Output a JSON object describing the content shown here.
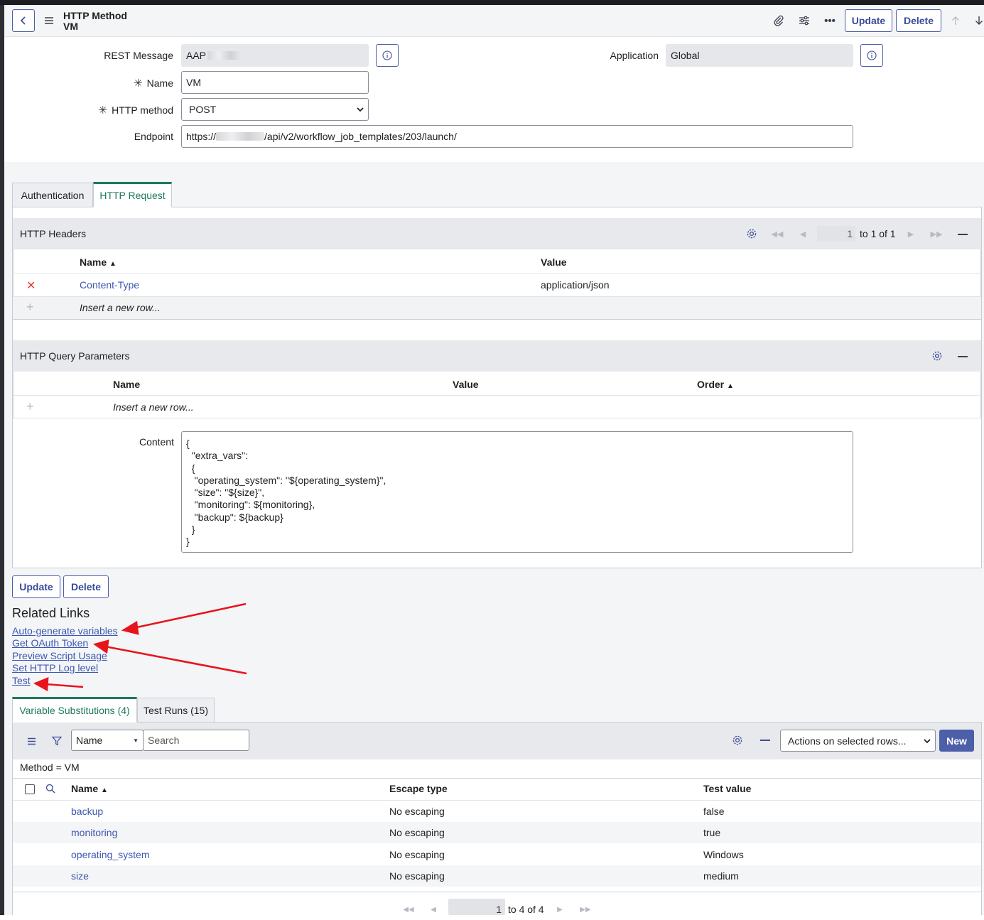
{
  "header": {
    "title_line1": "HTTP Method",
    "title_line2": "VM",
    "update_label": "Update",
    "delete_label": "Delete",
    "icons": [
      "back-icon",
      "menu-icon",
      "attachment-icon",
      "settings-sliders-icon",
      "more-icon",
      "arrow-up-icon",
      "arrow-down-icon"
    ]
  },
  "form": {
    "rest_message_label": "REST Message",
    "rest_message_value": "AAP",
    "application_label": "Application",
    "application_value": "Global",
    "name_label": "Name",
    "name_value": "VM",
    "http_method_label": "HTTP method",
    "http_method_value": "POST",
    "endpoint_label": "Endpoint",
    "endpoint_prefix": "https://",
    "endpoint_suffix": "/api/v2/workflow_job_templates/203/launch/",
    "required_mark": "✳"
  },
  "tabs": [
    {
      "label": "Authentication",
      "active": false
    },
    {
      "label": "HTTP Request",
      "active": true
    }
  ],
  "http_headers": {
    "title": "HTTP Headers",
    "page_current": "1",
    "page_text": "to 1 of 1",
    "columns": [
      "Name",
      "Value"
    ],
    "rows": [
      {
        "name": "Content-Type",
        "value": "application/json"
      }
    ],
    "insert_text": "Insert a new row..."
  },
  "http_query": {
    "title": "HTTP Query Parameters",
    "columns": [
      "Name",
      "Value",
      "Order"
    ],
    "insert_text": "Insert a new row..."
  },
  "content": {
    "label": "Content",
    "value": "{\n  \"extra_vars\":\n  {\n   \"operating_system\": \"${operating_system}\",\n   \"size\": \"${size}\",\n   \"monitoring\": ${monitoring},\n   \"backup\": ${backup}\n  }\n}"
  },
  "bottom_buttons": {
    "update_label": "Update",
    "delete_label": "Delete"
  },
  "related_links": {
    "title": "Related Links",
    "items": [
      "Auto-generate variables",
      "Get OAuth Token",
      "Preview Script Usage",
      "Set HTTP Log level",
      "Test"
    ]
  },
  "related_tabs": [
    {
      "label": "Variable Substitutions (4)",
      "active": true
    },
    {
      "label": "Test Runs (15)",
      "active": false
    }
  ],
  "var_list": {
    "search_field": "Name",
    "search_placeholder": "Search",
    "actions_label": "Actions on selected rows...",
    "new_label": "New",
    "filter_text": "Method = VM",
    "columns": [
      "Name",
      "Escape type",
      "Test value"
    ],
    "rows": [
      {
        "name": "backup",
        "escape": "No escaping",
        "test": "false"
      },
      {
        "name": "monitoring",
        "escape": "No escaping",
        "test": "true"
      },
      {
        "name": "operating_system",
        "escape": "No escaping",
        "test": "Windows"
      },
      {
        "name": "size",
        "escape": "No escaping",
        "test": "medium"
      }
    ],
    "page_current": "1",
    "page_text": "to 4 of 4"
  },
  "colors": {
    "accent": "#4d5fa8",
    "active_tab": "#1d7a5c",
    "link": "#3b56b3",
    "annotation_arrow": "#e8141c"
  }
}
